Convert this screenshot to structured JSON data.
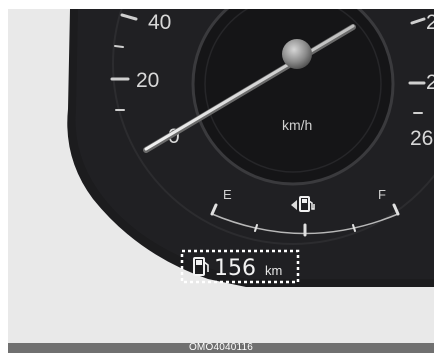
{
  "speedometer": {
    "tick_labels": [
      "40",
      "20",
      "0"
    ],
    "right_tick_labels": [
      "2",
      "2",
      "26"
    ],
    "unit": "km/h"
  },
  "fuel_gauge": {
    "empty_label": "E",
    "full_label": "F"
  },
  "range_display": {
    "value": "156",
    "unit": "km"
  },
  "caption": {
    "code": "OMO4040116"
  },
  "colors": {
    "cluster_bg": "#1c1c1e",
    "highlight_box": "#ffffff",
    "footer_bar": "#707070"
  },
  "icons": [
    "fuel-pump-icon",
    "fuel-door-arrow-icon"
  ]
}
